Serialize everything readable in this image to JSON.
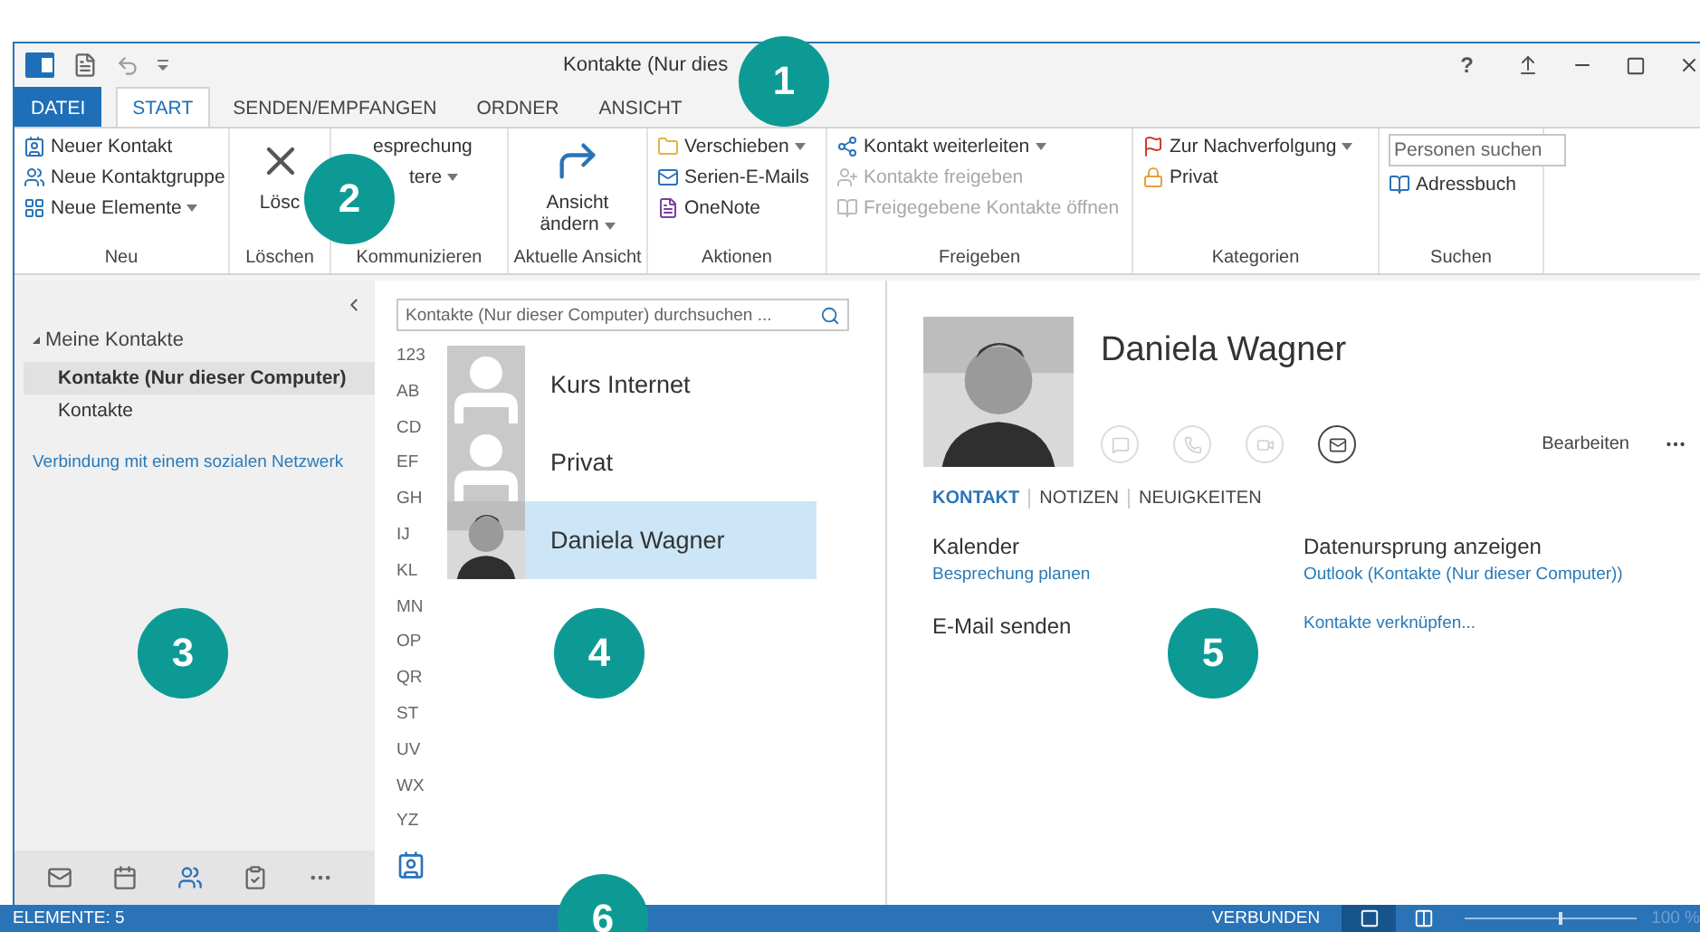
{
  "title_bar": {
    "title": "Kontakte (Nur dies",
    "help": "?"
  },
  "ribbon_tabs": [
    {
      "label": "DATEI",
      "kind": "file",
      "selected": false
    },
    {
      "label": "START",
      "kind": "tab",
      "selected": true
    },
    {
      "label": "SENDEN/EMPFANGEN",
      "kind": "tab",
      "selected": false
    },
    {
      "label": "ORDNER",
      "kind": "tab",
      "selected": false
    },
    {
      "label": "ANSICHT",
      "kind": "tab",
      "selected": false
    }
  ],
  "ribbon_groups": [
    {
      "label": "Neu",
      "items": [
        {
          "kind": "small",
          "label": "Neuer Kontakt",
          "dropdown": false,
          "disabled": false
        },
        {
          "kind": "small",
          "label": "Neue Kontaktgruppe",
          "dropdown": false,
          "disabled": false
        },
        {
          "kind": "small",
          "label": "Neue Elemente",
          "dropdown": true,
          "disabled": false
        }
      ]
    },
    {
      "label": "Löschen",
      "items": [
        {
          "kind": "large",
          "label": "Lösc",
          "dropdown": false,
          "disabled": false
        }
      ]
    },
    {
      "label": "Kommunizieren",
      "items": [
        {
          "kind": "fragment",
          "label": "esprechung",
          "dropdown": false,
          "disabled": false
        },
        {
          "kind": "fragment",
          "label": "tere",
          "dropdown": true,
          "disabled": false
        }
      ]
    },
    {
      "label": "Aktuelle Ansicht",
      "items": [
        {
          "kind": "large",
          "label": "Ansicht ändern",
          "dropdown": true,
          "disabled": false
        }
      ]
    },
    {
      "label": "Aktionen",
      "items": [
        {
          "kind": "small",
          "label": "Verschieben",
          "dropdown": true,
          "disabled": false
        },
        {
          "kind": "small",
          "label": "Serien-E-Mails",
          "dropdown": false,
          "disabled": false
        },
        {
          "kind": "small",
          "label": "OneNote",
          "dropdown": false,
          "disabled": false
        }
      ]
    },
    {
      "label": "Freigeben",
      "items": [
        {
          "kind": "small",
          "label": "Kontakt weiterleiten",
          "dropdown": true,
          "disabled": false
        },
        {
          "kind": "small",
          "label": "Kontakte freigeben",
          "dropdown": false,
          "disabled": true
        },
        {
          "kind": "small",
          "label": "Freigegebene Kontakte öffnen",
          "dropdown": false,
          "disabled": true
        }
      ]
    },
    {
      "label": "Kategorien",
      "items": [
        {
          "kind": "small",
          "label": "Zur Nachverfolgung",
          "dropdown": true,
          "disabled": false
        },
        {
          "kind": "small",
          "label": "Privat",
          "dropdown": false,
          "disabled": false
        }
      ]
    },
    {
      "label": "Suchen",
      "items": [
        {
          "kind": "search",
          "placeholder": "Personen suchen"
        },
        {
          "kind": "small",
          "label": "Adressbuch",
          "dropdown": false,
          "disabled": false
        }
      ]
    }
  ],
  "folder_pane": {
    "heading": "Meine Kontakte",
    "expanded": true,
    "folders": [
      {
        "label": "Kontakte (Nur dieser Computer)",
        "selected": true
      },
      {
        "label": "Kontakte",
        "selected": false
      }
    ],
    "link": "Verbindung mit einem sozialen Netzwerk",
    "nav_items": [
      {
        "kind": "mail",
        "selected": false
      },
      {
        "kind": "calendar",
        "selected": false
      },
      {
        "kind": "people",
        "selected": true
      },
      {
        "kind": "tasks",
        "selected": false
      },
      {
        "kind": "more",
        "selected": false
      }
    ]
  },
  "contact_list": {
    "search_placeholder": "Kontakte (Nur dieser Computer) durchsuchen ...",
    "index": [
      "123",
      "AB",
      "CD",
      "EF",
      "GH",
      "IJ",
      "KL",
      "MN",
      "OP",
      "QR",
      "ST",
      "UV",
      "WX",
      "YZ"
    ],
    "contacts": [
      {
        "name": "Kurs Internet",
        "kind": "group",
        "selected": false
      },
      {
        "name": "Privat",
        "kind": "group",
        "selected": false
      },
      {
        "name": "Daniela Wagner",
        "kind": "person",
        "selected": true
      }
    ]
  },
  "contact_card": {
    "name": "Daniela Wagner",
    "actions": [
      {
        "kind": "chat",
        "disabled": true
      },
      {
        "kind": "phone",
        "disabled": true
      },
      {
        "kind": "video",
        "disabled": true
      },
      {
        "kind": "mail",
        "disabled": false
      }
    ],
    "edit": "Bearbeiten",
    "tabs": [
      {
        "label": "KONTAKT",
        "selected": true
      },
      {
        "label": "NOTIZEN",
        "selected": false
      },
      {
        "label": "NEUIGKEITEN",
        "selected": false
      }
    ],
    "left_sections": [
      {
        "heading": "Kalender",
        "link": "Besprechung planen"
      },
      {
        "heading": "E-Mail senden"
      }
    ],
    "right_sections": [
      {
        "heading": "Datenursprung anzeigen",
        "link": "Outlook (Kontakte (Nur dieser Computer))"
      },
      {
        "link": "Kontakte verknüpfen..."
      }
    ]
  },
  "status_bar": {
    "items": "ELEMENTE: 5",
    "connection": "VERBUNDEN",
    "views": [
      {
        "selected": true
      },
      {
        "selected": false
      }
    ],
    "zoom": {
      "level": 0.55,
      "reading": "100 %"
    }
  },
  "callouts": [
    "1",
    "2",
    "3",
    "4",
    "5",
    "6"
  ]
}
